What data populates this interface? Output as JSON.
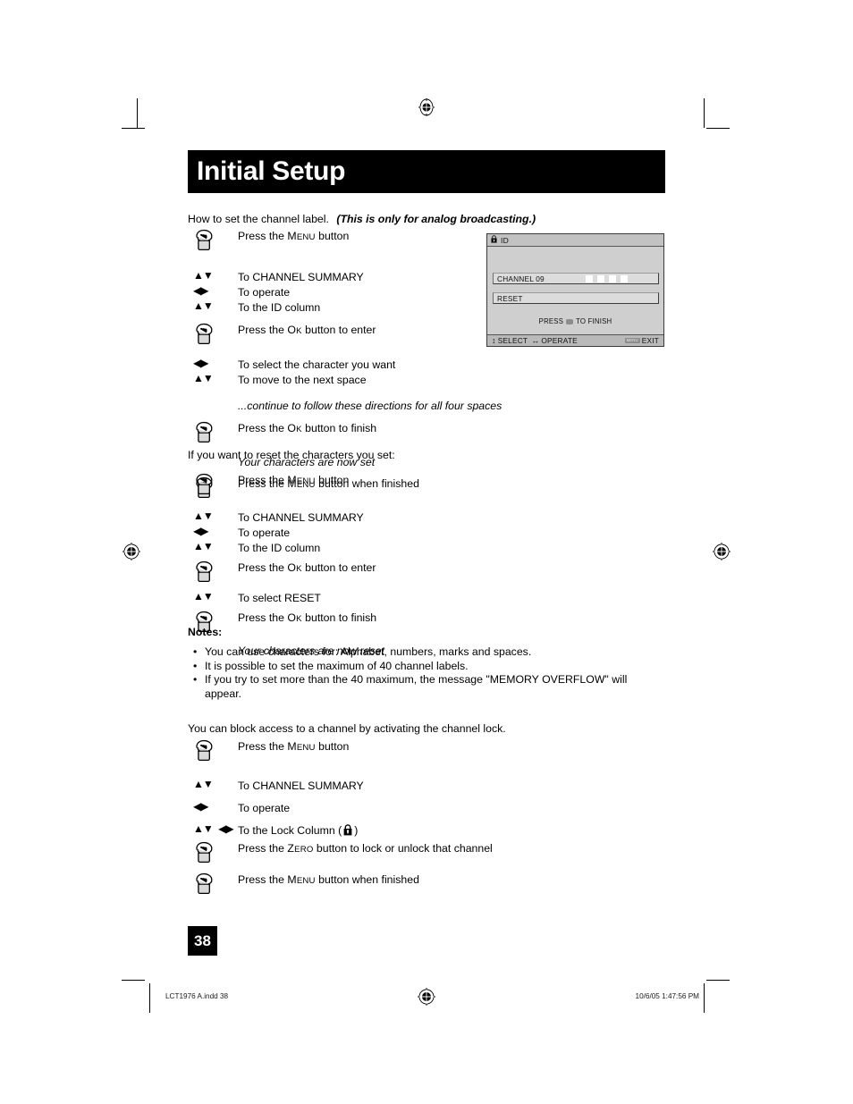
{
  "page_title": "Initial Setup",
  "section1": {
    "intro_plain": "How to set the channel label.",
    "intro_emphasis": "(This is only for analog broadcasting.)",
    "steps": [
      {
        "icon": "hand-press-icon",
        "text_pre": "Press the ",
        "sc": "Menu",
        "text_post": " button"
      },
      {
        "icon": "up-down-arrows-icon",
        "text_pre": "To CHANNEL SUMMARY",
        "sc": "",
        "text_post": ""
      },
      {
        "icon": "left-right-arrows-icon",
        "text_pre": "To operate",
        "sc": "",
        "text_post": ""
      },
      {
        "icon": "up-down-arrows-icon",
        "text_pre": "To the ID column",
        "sc": "",
        "text_post": ""
      },
      {
        "icon": "hand-press-icon",
        "text_pre": "Press the ",
        "sc": "Ok",
        "text_post": " button to enter"
      },
      {
        "icon": "left-right-arrows-icon",
        "text_pre": "To select the character you want",
        "sc": "",
        "text_post": ""
      },
      {
        "icon": "up-down-arrows-icon",
        "text_pre": "To move to the next space",
        "sc": "",
        "text_post": ""
      },
      {
        "icon": "none",
        "italic": true,
        "text_pre": "...continue to follow these directions for all four spaces",
        "sc": "",
        "text_post": ""
      },
      {
        "icon": "hand-press-icon",
        "text_pre": "Press the ",
        "sc": "Ok",
        "text_post": " button to finish"
      },
      {
        "icon": "none",
        "italic": true,
        "text_pre": "Your characters are now set",
        "sc": "",
        "text_post": ""
      },
      {
        "icon": "hand-press-icon",
        "text_pre": "Press the ",
        "sc": "Menu",
        "text_post": " button when finished"
      }
    ]
  },
  "section2": {
    "intro_plain": "If you want to reset the characters you set:",
    "steps": [
      {
        "icon": "hand-press-icon",
        "text_pre": "Press the ",
        "sc": "Menu",
        "text_post": " button"
      },
      {
        "icon": "up-down-arrows-icon",
        "text_pre": "To CHANNEL SUMMARY",
        "sc": "",
        "text_post": ""
      },
      {
        "icon": "left-right-arrows-icon",
        "text_pre": "To operate",
        "sc": "",
        "text_post": ""
      },
      {
        "icon": "up-down-arrows-icon",
        "text_pre": "To the ID column",
        "sc": "",
        "text_post": ""
      },
      {
        "icon": "hand-press-icon",
        "text_pre": "Press the ",
        "sc": "Ok",
        "text_post": " button to enter"
      },
      {
        "icon": "up-down-arrows-icon",
        "text_pre": "To select RESET",
        "sc": "",
        "text_post": ""
      },
      {
        "icon": "hand-press-icon",
        "text_pre": "Press the ",
        "sc": "Ok",
        "text_post": " button to finish"
      },
      {
        "icon": "none",
        "italic": true,
        "text_pre": "Your characters are now reset",
        "sc": "",
        "text_post": ""
      }
    ]
  },
  "notes": {
    "heading": "Notes:",
    "bullet": "•",
    "items": [
      "You can use characters for: Alphabet, numbers, marks and spaces.",
      "It is possible to set the maximum of 40 channel labels.",
      "If you try to set more than the 40 maximum, the message \"MEMORY OVERFLOW\" will appear."
    ]
  },
  "section3": {
    "intro_plain": "You can block access to a channel by activating the channel lock.",
    "steps": [
      {
        "icon": "hand-press-icon",
        "text_pre": "Press the ",
        "sc": "Menu",
        "text_post": " button"
      },
      {
        "icon": "up-down-arrows-icon",
        "text_pre": "To CHANNEL SUMMARY",
        "sc": "",
        "text_post": ""
      },
      {
        "icon": "left-right-arrows-icon",
        "text_pre": "To operate",
        "sc": "",
        "text_post": ""
      },
      {
        "icon": "four-arrows-icon",
        "text_pre": "To the Lock Column (",
        "sc": "",
        "text_post": ")",
        "lock": true
      },
      {
        "icon": "hand-press-icon",
        "text_pre": "Press the ",
        "sc": "Zero",
        "text_post": " button to lock or unlock that channel"
      },
      {
        "icon": "hand-press-icon",
        "text_pre": "Press the ",
        "sc": "Menu",
        "text_post": " button when finished"
      }
    ]
  },
  "osd": {
    "header_icon": "lock-id-icon",
    "header_title": "ID",
    "rows": [
      {
        "label": "CHANNEL 09",
        "slots": 4
      },
      {
        "label": "RESET",
        "slots": 0
      }
    ],
    "finish_pre": "PRESS",
    "finish_chip": "ok-button-chip",
    "finish_post": "TO FINISH",
    "footer": {
      "select_arrows": "↕",
      "select_label": "SELECT",
      "operate_arrows": "↔",
      "operate_label": "OPERATE",
      "exit_chip": "MENU",
      "exit_label": "EXIT"
    }
  },
  "page_number": "38",
  "footer_imprint": {
    "left": "LCT1976 A.indd   38",
    "right": "10/6/05   1:47:56 PM"
  },
  "colors": {
    "banner_bg": "#000000",
    "banner_fg": "#ffffff",
    "osd_bg": "#cfcfcf",
    "osd_row_bg": "#dcdcdc",
    "osd_footer_bg": "#b9b9b9",
    "slot_fill": "#ffffff"
  }
}
